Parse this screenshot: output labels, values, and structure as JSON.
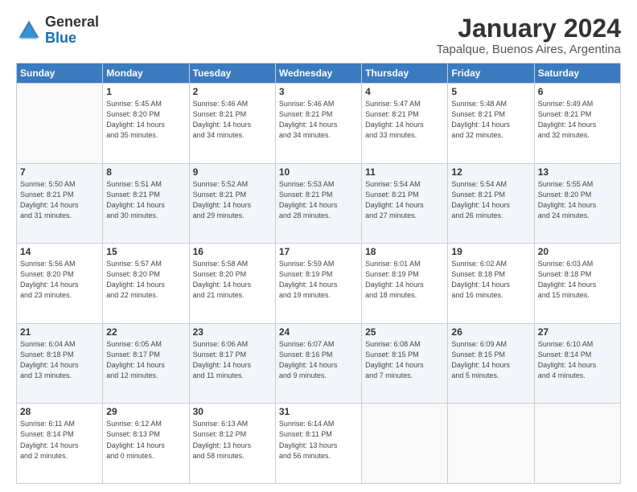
{
  "header": {
    "logo_general": "General",
    "logo_blue": "Blue",
    "month": "January 2024",
    "location": "Tapalque, Buenos Aires, Argentina"
  },
  "weekdays": [
    "Sunday",
    "Monday",
    "Tuesday",
    "Wednesday",
    "Thursday",
    "Friday",
    "Saturday"
  ],
  "weeks": [
    [
      {
        "day": "",
        "info": ""
      },
      {
        "day": "1",
        "info": "Sunrise: 5:45 AM\nSunset: 8:20 PM\nDaylight: 14 hours\nand 35 minutes."
      },
      {
        "day": "2",
        "info": "Sunrise: 5:46 AM\nSunset: 8:21 PM\nDaylight: 14 hours\nand 34 minutes."
      },
      {
        "day": "3",
        "info": "Sunrise: 5:46 AM\nSunset: 8:21 PM\nDaylight: 14 hours\nand 34 minutes."
      },
      {
        "day": "4",
        "info": "Sunrise: 5:47 AM\nSunset: 8:21 PM\nDaylight: 14 hours\nand 33 minutes."
      },
      {
        "day": "5",
        "info": "Sunrise: 5:48 AM\nSunset: 8:21 PM\nDaylight: 14 hours\nand 32 minutes."
      },
      {
        "day": "6",
        "info": "Sunrise: 5:49 AM\nSunset: 8:21 PM\nDaylight: 14 hours\nand 32 minutes."
      }
    ],
    [
      {
        "day": "7",
        "info": "Sunrise: 5:50 AM\nSunset: 8:21 PM\nDaylight: 14 hours\nand 31 minutes."
      },
      {
        "day": "8",
        "info": "Sunrise: 5:51 AM\nSunset: 8:21 PM\nDaylight: 14 hours\nand 30 minutes."
      },
      {
        "day": "9",
        "info": "Sunrise: 5:52 AM\nSunset: 8:21 PM\nDaylight: 14 hours\nand 29 minutes."
      },
      {
        "day": "10",
        "info": "Sunrise: 5:53 AM\nSunset: 8:21 PM\nDaylight: 14 hours\nand 28 minutes."
      },
      {
        "day": "11",
        "info": "Sunrise: 5:54 AM\nSunset: 8:21 PM\nDaylight: 14 hours\nand 27 minutes."
      },
      {
        "day": "12",
        "info": "Sunrise: 5:54 AM\nSunset: 8:21 PM\nDaylight: 14 hours\nand 26 minutes."
      },
      {
        "day": "13",
        "info": "Sunrise: 5:55 AM\nSunset: 8:20 PM\nDaylight: 14 hours\nand 24 minutes."
      }
    ],
    [
      {
        "day": "14",
        "info": "Sunrise: 5:56 AM\nSunset: 8:20 PM\nDaylight: 14 hours\nand 23 minutes."
      },
      {
        "day": "15",
        "info": "Sunrise: 5:57 AM\nSunset: 8:20 PM\nDaylight: 14 hours\nand 22 minutes."
      },
      {
        "day": "16",
        "info": "Sunrise: 5:58 AM\nSunset: 8:20 PM\nDaylight: 14 hours\nand 21 minutes."
      },
      {
        "day": "17",
        "info": "Sunrise: 5:59 AM\nSunset: 8:19 PM\nDaylight: 14 hours\nand 19 minutes."
      },
      {
        "day": "18",
        "info": "Sunrise: 6:01 AM\nSunset: 8:19 PM\nDaylight: 14 hours\nand 18 minutes."
      },
      {
        "day": "19",
        "info": "Sunrise: 6:02 AM\nSunset: 8:18 PM\nDaylight: 14 hours\nand 16 minutes."
      },
      {
        "day": "20",
        "info": "Sunrise: 6:03 AM\nSunset: 8:18 PM\nDaylight: 14 hours\nand 15 minutes."
      }
    ],
    [
      {
        "day": "21",
        "info": "Sunrise: 6:04 AM\nSunset: 8:18 PM\nDaylight: 14 hours\nand 13 minutes."
      },
      {
        "day": "22",
        "info": "Sunrise: 6:05 AM\nSunset: 8:17 PM\nDaylight: 14 hours\nand 12 minutes."
      },
      {
        "day": "23",
        "info": "Sunrise: 6:06 AM\nSunset: 8:17 PM\nDaylight: 14 hours\nand 11 minutes."
      },
      {
        "day": "24",
        "info": "Sunrise: 6:07 AM\nSunset: 8:16 PM\nDaylight: 14 hours\nand 9 minutes."
      },
      {
        "day": "25",
        "info": "Sunrise: 6:08 AM\nSunset: 8:15 PM\nDaylight: 14 hours\nand 7 minutes."
      },
      {
        "day": "26",
        "info": "Sunrise: 6:09 AM\nSunset: 8:15 PM\nDaylight: 14 hours\nand 5 minutes."
      },
      {
        "day": "27",
        "info": "Sunrise: 6:10 AM\nSunset: 8:14 PM\nDaylight: 14 hours\nand 4 minutes."
      }
    ],
    [
      {
        "day": "28",
        "info": "Sunrise: 6:11 AM\nSunset: 8:14 PM\nDaylight: 14 hours\nand 2 minutes."
      },
      {
        "day": "29",
        "info": "Sunrise: 6:12 AM\nSunset: 8:13 PM\nDaylight: 14 hours\nand 0 minutes."
      },
      {
        "day": "30",
        "info": "Sunrise: 6:13 AM\nSunset: 8:12 PM\nDaylight: 13 hours\nand 58 minutes."
      },
      {
        "day": "31",
        "info": "Sunrise: 6:14 AM\nSunset: 8:11 PM\nDaylight: 13 hours\nand 56 minutes."
      },
      {
        "day": "",
        "info": ""
      },
      {
        "day": "",
        "info": ""
      },
      {
        "day": "",
        "info": ""
      }
    ]
  ]
}
